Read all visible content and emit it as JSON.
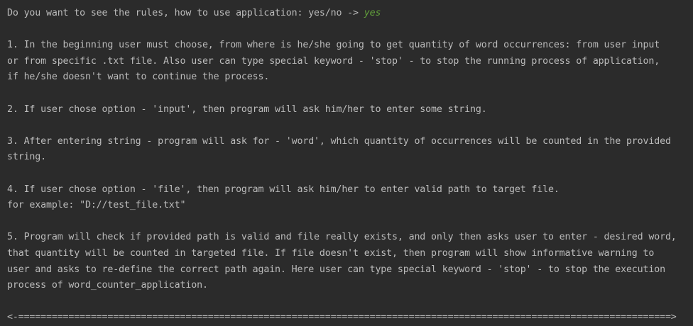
{
  "console": {
    "prompt": "Do you want to see the rules, how to use application: yes/no -> ",
    "user_answer": "yes",
    "lines": [
      "1. In the beginning user must choose, from where is he/she going to get quantity of word occurrences: from user input",
      "or from specific .txt file. Also user can type special keyword - 'stop' - to stop the running process of application,",
      "if he/she doesn't want to continue the process.",
      "2. If user chose option - 'input', then program will ask him/her to enter some string.",
      "3. After entering string - program will ask for - 'word', which quantity of occurrences will be counted in the provided",
      "string.",
      "4. If user chose option - 'file', then program will ask him/her to enter valid path to target file.",
      "for example: \"D://test_file.txt\"",
      "5. Program will check if provided path is valid and file really exists, and only then asks user to enter - desired word,",
      "that quantity will be counted in targeted file. If file doesn't exist, then program will show informative warning to",
      "user and asks to re-define the correct path again. Here user can type special keyword - 'stop' - to stop the execution",
      "process of word_counter_application."
    ],
    "separator": "<-=====================================================================================================================>"
  }
}
